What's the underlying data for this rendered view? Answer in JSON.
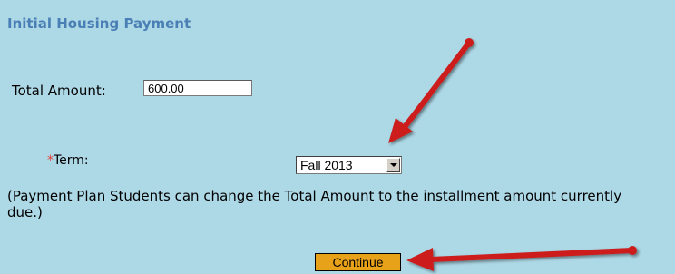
{
  "title": "Initial Housing Payment",
  "total_amount": {
    "label": "Total Amount:",
    "value": "600.00"
  },
  "term": {
    "required_mark": "*",
    "label": "Term:",
    "selected": "Fall 2013"
  },
  "note": "(Payment Plan Students can change the Total Amount to the installment amount currently due.)",
  "continue_label": "Continue",
  "colors": {
    "background": "#add8e6",
    "title": "#4a7fb5",
    "required": "#e8423a",
    "button": "#e8a21a",
    "arrow": "#cc1a1a"
  },
  "annotations": [
    "red-arrow-pointing-at-term",
    "red-arrow-pointing-at-continue"
  ]
}
